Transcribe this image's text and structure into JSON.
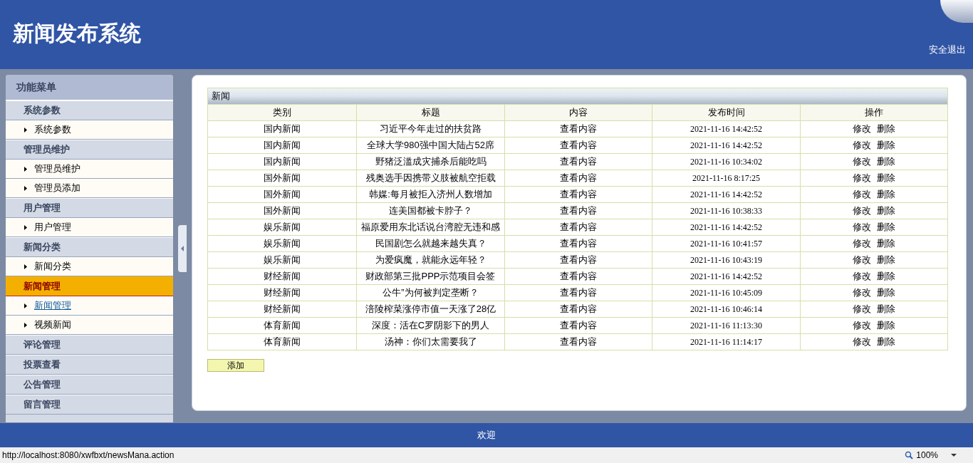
{
  "header": {
    "title": "新闻发布系统",
    "logout": "安全退出"
  },
  "sidebar": {
    "title": "功能菜单",
    "groups": [
      {
        "label": "系统参数",
        "selected": false,
        "items": [
          {
            "label": "系统参数",
            "selected": false
          }
        ]
      },
      {
        "label": "管理员维护",
        "selected": false,
        "items": [
          {
            "label": "管理员维护",
            "selected": false
          },
          {
            "label": "管理员添加",
            "selected": false
          }
        ]
      },
      {
        "label": "用户管理",
        "selected": false,
        "items": [
          {
            "label": "用户管理",
            "selected": false
          }
        ]
      },
      {
        "label": "新闻分类",
        "selected": false,
        "items": [
          {
            "label": "新闻分类",
            "selected": false
          }
        ]
      },
      {
        "label": "新闻管理",
        "selected": true,
        "items": [
          {
            "label": "新闻管理",
            "selected": true
          },
          {
            "label": "视频新闻",
            "selected": false
          }
        ]
      },
      {
        "label": "评论管理",
        "selected": false
      },
      {
        "label": "投票查看",
        "selected": false
      },
      {
        "label": "公告管理",
        "selected": false
      },
      {
        "label": "留言管理",
        "selected": false
      }
    ]
  },
  "table": {
    "caption": "新闻",
    "columns": [
      "类别",
      "标题",
      "内容",
      "发布时间",
      "操作"
    ],
    "rows": [
      {
        "category": "国内新闻",
        "title": "习近平今年走过的扶贫路",
        "content": "查看内容",
        "time": "2021-11-16 14:42:52",
        "actions": [
          "修改",
          "删除"
        ]
      },
      {
        "category": "国内新闻",
        "title": "全球大学980强中国大陆占52席",
        "content": "查看内容",
        "time": "2021-11-16 14:42:52",
        "actions": [
          "修改",
          "删除"
        ]
      },
      {
        "category": "国内新闻",
        "title": "野猪泛滥成灾捕杀后能吃吗",
        "content": "查看内容",
        "time": "2021-11-16 10:34:02",
        "actions": [
          "修改",
          "删除"
        ]
      },
      {
        "category": "国外新闻",
        "title": "残奥选手因携带义肢被航空拒载",
        "content": "查看内容",
        "time": "2021-11-16 8:17:25",
        "actions": [
          "修改",
          "删除"
        ]
      },
      {
        "category": "国外新闻",
        "title": "韩媒:每月被拒入济州人数增加",
        "content": "查看内容",
        "time": "2021-11-16 14:42:52",
        "actions": [
          "修改",
          "删除"
        ]
      },
      {
        "category": "国外新闻",
        "title": "连美国都被卡脖子？",
        "content": "查看内容",
        "time": "2021-11-16 10:38:33",
        "actions": [
          "修改",
          "删除"
        ]
      },
      {
        "category": "娱乐新闻",
        "title": "福原爱用东北话说台湾腔无违和感",
        "content": "查看内容",
        "time": "2021-11-16 14:42:52",
        "actions": [
          "修改",
          "删除"
        ]
      },
      {
        "category": "娱乐新闻",
        "title": "民国剧怎么就越来越失真？",
        "content": "查看内容",
        "time": "2021-11-16 10:41:57",
        "actions": [
          "修改",
          "删除"
        ]
      },
      {
        "category": "娱乐新闻",
        "title": "为爱疯魔，就能永远年轻？",
        "content": "查看内容",
        "time": "2021-11-16 10:43:19",
        "actions": [
          "修改",
          "删除"
        ]
      },
      {
        "category": "财经新闻",
        "title": "财政部第三批PPP示范项目会签",
        "content": "查看内容",
        "time": "2021-11-16 14:42:52",
        "actions": [
          "修改",
          "删除"
        ]
      },
      {
        "category": "财经新闻",
        "title": "公牛”为何被判定垄断？",
        "content": "查看内容",
        "time": "2021-11-16 10:45:09",
        "actions": [
          "修改",
          "删除"
        ]
      },
      {
        "category": "财经新闻",
        "title": "涪陵榨菜涨停市值一天涨了28亿",
        "content": "查看内容",
        "time": "2021-11-16 10:46:14",
        "actions": [
          "修改",
          "删除"
        ]
      },
      {
        "category": "体育新闻",
        "title": "深度：活在C罗阴影下的男人",
        "content": "查看内容",
        "time": "2021-11-16 11:13:30",
        "actions": [
          "修改",
          "删除"
        ]
      },
      {
        "category": "体育新闻",
        "title": "汤神：你们太需要我了",
        "content": "查看内容",
        "time": "2021-11-16 11:14:17",
        "actions": [
          "修改",
          "删除"
        ]
      }
    ]
  },
  "add_button": "添加",
  "footer": "欢迎",
  "status_bar": {
    "url": "http://localhost:8080/xwfbxt/newsMana.action",
    "zoom": "100%"
  }
}
